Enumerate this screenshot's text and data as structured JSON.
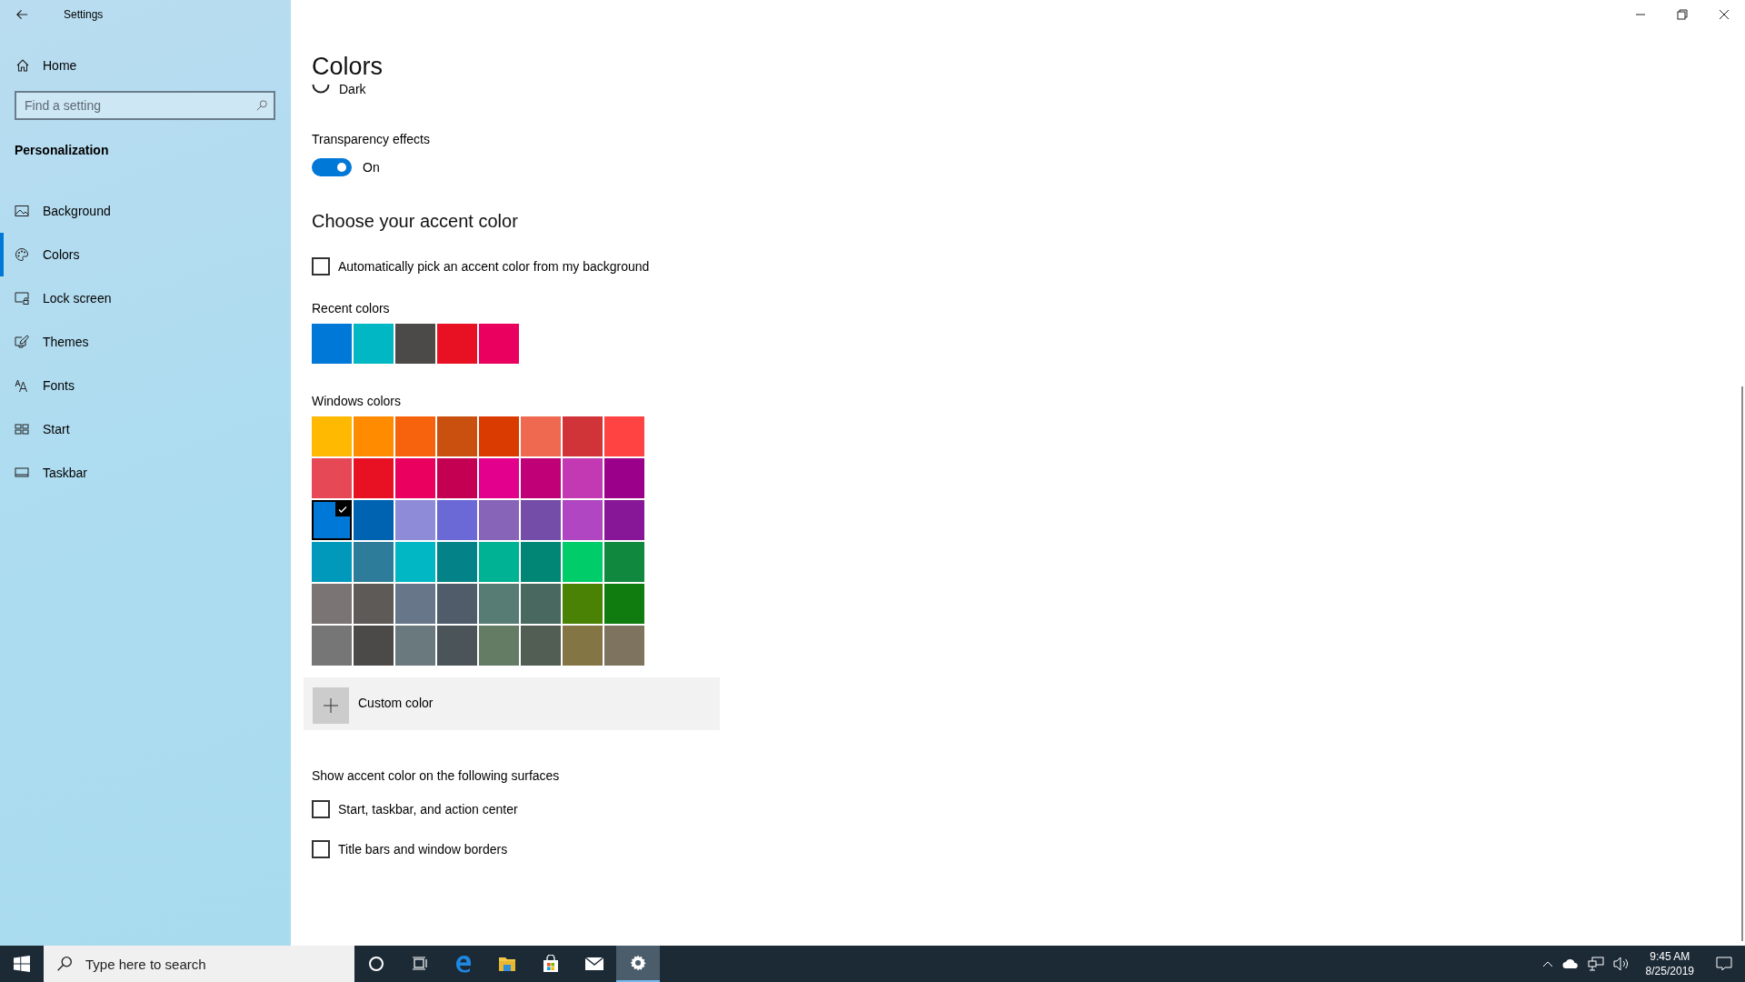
{
  "window": {
    "title": "Settings"
  },
  "sidebar": {
    "home": "Home",
    "search": {
      "placeholder": "Find a setting"
    },
    "section": "Personalization",
    "items": [
      {
        "label": "Background",
        "selected": false
      },
      {
        "label": "Colors",
        "selected": true
      },
      {
        "label": "Lock screen",
        "selected": false
      },
      {
        "label": "Themes",
        "selected": false
      },
      {
        "label": "Fonts",
        "selected": false
      },
      {
        "label": "Start",
        "selected": false
      },
      {
        "label": "Taskbar",
        "selected": false
      }
    ]
  },
  "main": {
    "title": "Colors",
    "mode_option": {
      "label": "Dark",
      "selected": false
    },
    "transparency": {
      "label": "Transparency effects",
      "on": true,
      "state_label": "On"
    },
    "accent_heading": "Choose your accent color",
    "auto_pick": {
      "label": "Automatically pick an accent color from my background",
      "checked": false
    },
    "recent": {
      "label": "Recent colors",
      "colors": [
        {
          "color": "#0078d7"
        },
        {
          "color": "#00b7c3"
        },
        {
          "color": "#4c4a48"
        },
        {
          "color": "#e81123"
        },
        {
          "color": "#ea005e"
        }
      ]
    },
    "windows_colors": {
      "label": "Windows colors",
      "rows": [
        {
          "swatches": [
            {
              "color": "#ffb900",
              "selected": false
            },
            {
              "color": "#ff8c00",
              "selected": false
            },
            {
              "color": "#f7630c",
              "selected": false
            },
            {
              "color": "#ca5010",
              "selected": false
            },
            {
              "color": "#da3b01",
              "selected": false
            },
            {
              "color": "#ef6950",
              "selected": false
            },
            {
              "color": "#d13438",
              "selected": false
            },
            {
              "color": "#ff4343",
              "selected": false
            }
          ]
        },
        {
          "swatches": [
            {
              "color": "#e74856",
              "selected": false
            },
            {
              "color": "#e81123",
              "selected": false
            },
            {
              "color": "#ea005e",
              "selected": false
            },
            {
              "color": "#c30052",
              "selected": false
            },
            {
              "color": "#e3008c",
              "selected": false
            },
            {
              "color": "#bf0077",
              "selected": false
            },
            {
              "color": "#c239b3",
              "selected": false
            },
            {
              "color": "#9a0089",
              "selected": false
            }
          ]
        },
        {
          "swatches": [
            {
              "color": "#0078d7",
              "selected": true
            },
            {
              "color": "#0063b1",
              "selected": false
            },
            {
              "color": "#8e8cd8",
              "selected": false
            },
            {
              "color": "#6b69d6",
              "selected": false
            },
            {
              "color": "#8764b8",
              "selected": false
            },
            {
              "color": "#744da9",
              "selected": false
            },
            {
              "color": "#b146c2",
              "selected": false
            },
            {
              "color": "#881798",
              "selected": false
            }
          ]
        },
        {
          "swatches": [
            {
              "color": "#0099bc",
              "selected": false
            },
            {
              "color": "#2d7d9a",
              "selected": false
            },
            {
              "color": "#00b7c3",
              "selected": false
            },
            {
              "color": "#038387",
              "selected": false
            },
            {
              "color": "#00b294",
              "selected": false
            },
            {
              "color": "#018574",
              "selected": false
            },
            {
              "color": "#00cc6a",
              "selected": false
            },
            {
              "color": "#10893e",
              "selected": false
            }
          ]
        },
        {
          "swatches": [
            {
              "color": "#7a7574",
              "selected": false
            },
            {
              "color": "#5d5a58",
              "selected": false
            },
            {
              "color": "#68768a",
              "selected": false
            },
            {
              "color": "#515c6b",
              "selected": false
            },
            {
              "color": "#567c73",
              "selected": false
            },
            {
              "color": "#486860",
              "selected": false
            },
            {
              "color": "#498205",
              "selected": false
            },
            {
              "color": "#107c10",
              "selected": false
            }
          ]
        },
        {
          "swatches": [
            {
              "color": "#767676",
              "selected": false
            },
            {
              "color": "#4c4a48",
              "selected": false
            },
            {
              "color": "#69797e",
              "selected": false
            },
            {
              "color": "#4a5459",
              "selected": false
            },
            {
              "color": "#647c64",
              "selected": false
            },
            {
              "color": "#525e54",
              "selected": false
            },
            {
              "color": "#847545",
              "selected": false
            },
            {
              "color": "#7e735f",
              "selected": false
            }
          ]
        }
      ]
    },
    "custom_color": {
      "label": "Custom color"
    },
    "surfaces": {
      "label": "Show accent color on the following surfaces",
      "options": [
        {
          "label": "Start, taskbar, and action center",
          "checked": false
        },
        {
          "label": "Title bars and window borders",
          "checked": false
        }
      ]
    }
  },
  "taskbar": {
    "search": {
      "placeholder": "Type here to search"
    },
    "apps": [
      {
        "selected": false
      },
      {
        "selected": false
      },
      {
        "selected": false
      },
      {
        "selected": false
      },
      {
        "selected": false
      },
      {
        "selected": false
      },
      {
        "selected": true
      }
    ],
    "clock": {
      "time": "9:45 AM",
      "date": "8/25/2019"
    }
  }
}
